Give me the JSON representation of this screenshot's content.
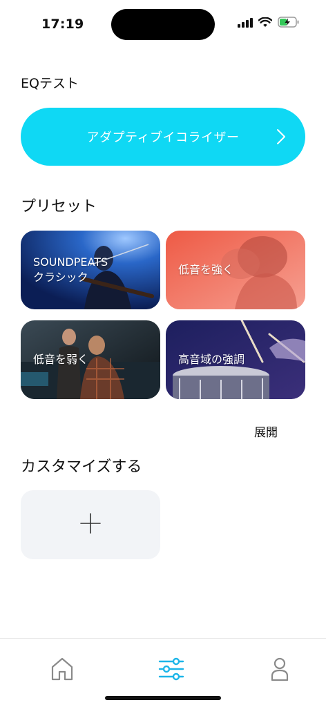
{
  "status_bar": {
    "time": "17:19"
  },
  "eq_test": {
    "title": "EQテスト",
    "adaptive_button_label": "アダプティブイコライザー"
  },
  "presets": {
    "title": "プリセット",
    "items": [
      {
        "label": "SOUNDPEATS\nクラシック",
        "icon": "violinist-photo"
      },
      {
        "label": "低音を強く",
        "icon": "headphone-man-photo"
      },
      {
        "label": "低音を弱く",
        "icon": "studio-photo"
      },
      {
        "label": "高音域の強調",
        "icon": "drummer-photo"
      }
    ],
    "expand_label": "展開"
  },
  "custom": {
    "title": "カスタマイズする",
    "add_icon": "plus-icon"
  },
  "tab_bar": {
    "items": [
      {
        "icon": "home-icon",
        "active": false
      },
      {
        "icon": "equalizer-icon",
        "active": true
      },
      {
        "icon": "profile-icon",
        "active": false
      }
    ]
  },
  "colors": {
    "accent": "#0fd8f4",
    "active_tab": "#1cb5e8",
    "inactive_tab": "#8a8a8a"
  }
}
